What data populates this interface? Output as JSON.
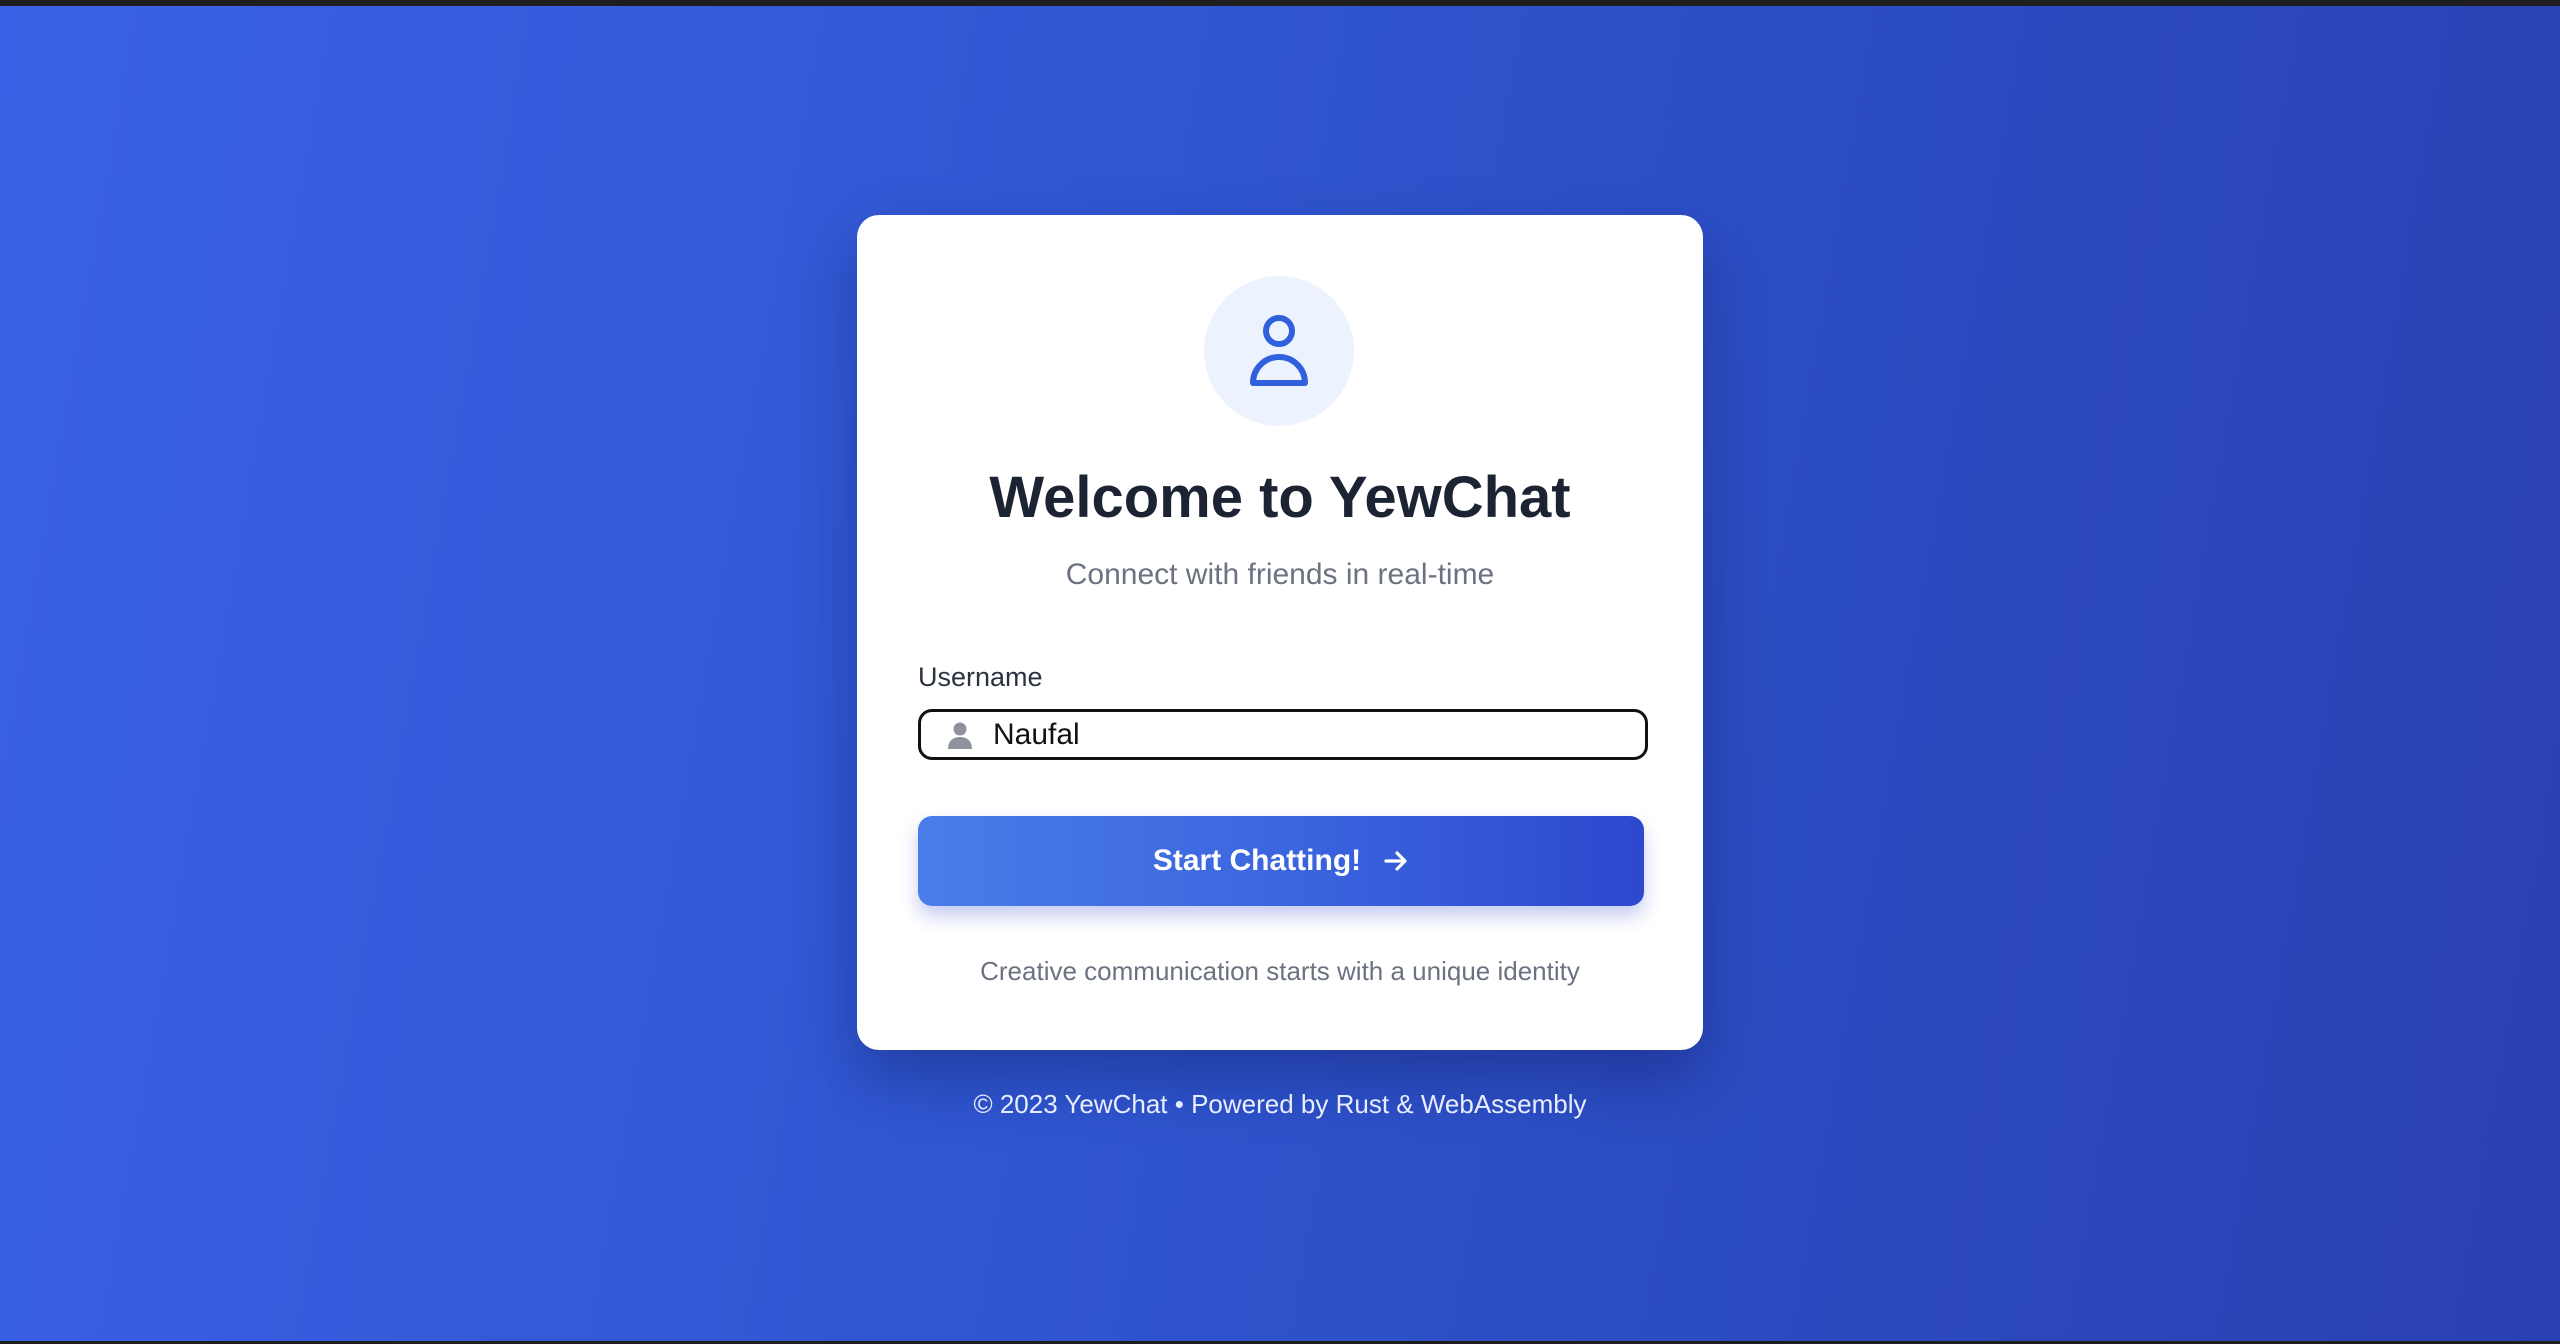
{
  "app": {
    "title": "Welcome to YewChat",
    "subtitle": "Connect with friends in real-time"
  },
  "form": {
    "username_label": "Username",
    "username_value": "Naufal",
    "username_icon": "user-icon",
    "submit_label": "Start Chatting!",
    "submit_icon": "arrow-right-icon"
  },
  "hint": "Creative communication starts with a unique identity",
  "footer": "© 2023 YewChat • Powered by Rust & WebAssembly",
  "colors": {
    "accent": "#3a63de",
    "background_start": "#3a62e6",
    "background_end": "#2940b0",
    "avatar_bg": "#ecf3ff"
  }
}
